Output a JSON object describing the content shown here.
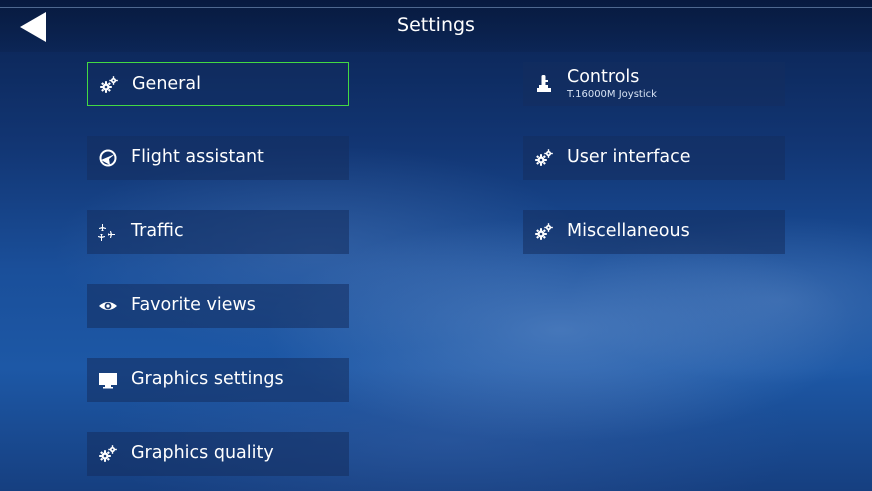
{
  "header": {
    "title": "Settings",
    "back_icon": "back-arrow-icon"
  },
  "left_column": [
    {
      "label": "General",
      "icon": "gears-icon",
      "selected": true
    },
    {
      "label": "Flight assistant",
      "icon": "flight-assistant-icon"
    },
    {
      "label": "Traffic",
      "icon": "traffic-icon"
    },
    {
      "label": "Favorite views",
      "icon": "eye-icon"
    },
    {
      "label": "Graphics settings",
      "icon": "monitor-icon"
    },
    {
      "label": "Graphics quality",
      "icon": "gears-icon"
    }
  ],
  "right_column": [
    {
      "label": "Controls",
      "sublabel": "T.16000M Joystick",
      "icon": "joystick-icon"
    },
    {
      "label": "User interface",
      "icon": "gears-icon"
    },
    {
      "label": "Miscellaneous",
      "icon": "gears-icon"
    }
  ],
  "colors": {
    "selection_border": "#43d943",
    "text": "#ffffff"
  }
}
